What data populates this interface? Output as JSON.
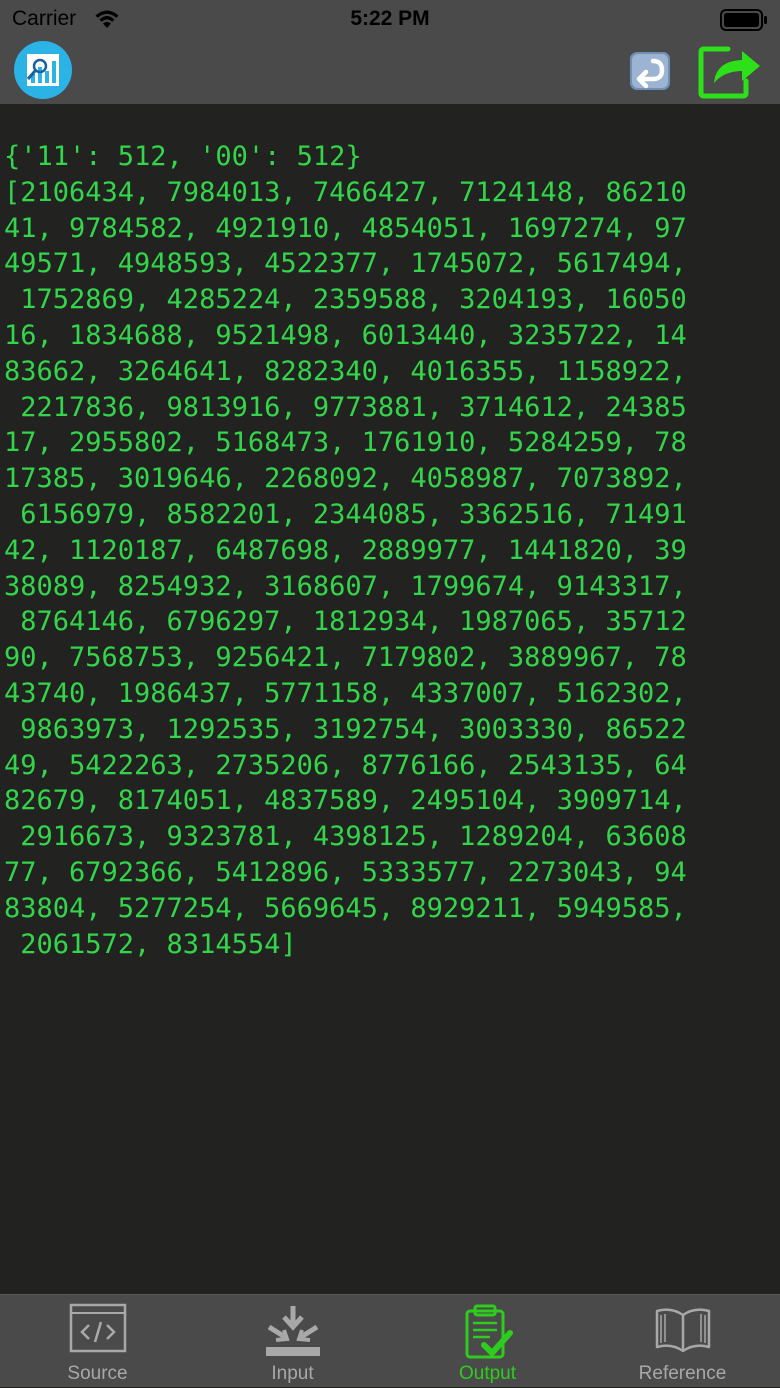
{
  "status_bar": {
    "carrier": "Carrier",
    "time": "5:22 PM"
  },
  "nav_bar": {
    "logo_icon": "chart-magnifier-logo",
    "undo_icon": "undo-arrow-icon",
    "share_icon": "share-arrow-icon"
  },
  "output": {
    "lines": [
      "{'11': 512, '00': 512}",
      "[2106434, 7984013, 7466427, 7124148, 86210",
      "41, 9784582, 4921910, 4854051, 1697274, 97",
      "49571, 4948593, 4522377, 1745072, 5617494,",
      " 1752869, 4285224, 2359588, 3204193, 16050",
      "16, 1834688, 9521498, 6013440, 3235722, 14",
      "83662, 3264641, 8282340, 4016355, 1158922,",
      " 2217836, 9813916, 9773881, 3714612, 24385",
      "17, 2955802, 5168473, 1761910, 5284259, 78",
      "17385, 3019646, 2268092, 4058987, 7073892,",
      " 6156979, 8582201, 2344085, 3362516, 71491",
      "42, 1120187, 6487698, 2889977, 1441820, 39",
      "38089, 8254932, 3168607, 1799674, 9143317,",
      " 8764146, 6796297, 1812934, 1987065, 35712",
      "90, 7568753, 9256421, 7179802, 3889967, 78",
      "43740, 1986437, 5771158, 4337007, 5162302,",
      " 9863973, 1292535, 3192754, 3003330, 86522",
      "49, 5422263, 2735206, 8776166, 2543135, 64",
      "82679, 8174051, 4837589, 2495104, 3909714,",
      " 2916673, 9323781, 4398125, 1289204, 63608",
      "77, 6792366, 5412896, 5333577, 2273043, 94",
      "83804, 5277254, 5669645, 8929211, 5949585,",
      " 2061572, 8314554]"
    ],
    "text_color": "#33d64b"
  },
  "tab_bar": {
    "tabs": [
      {
        "label": "Source",
        "icon": "code-icon",
        "active": false
      },
      {
        "label": "Input",
        "icon": "input-icon",
        "active": false
      },
      {
        "label": "Output",
        "icon": "clipboard-check-icon",
        "active": true
      },
      {
        "label": "Reference",
        "icon": "book-icon",
        "active": false
      }
    ],
    "active_color": "#2ecc1e",
    "inactive_color": "#a8a8a8"
  }
}
